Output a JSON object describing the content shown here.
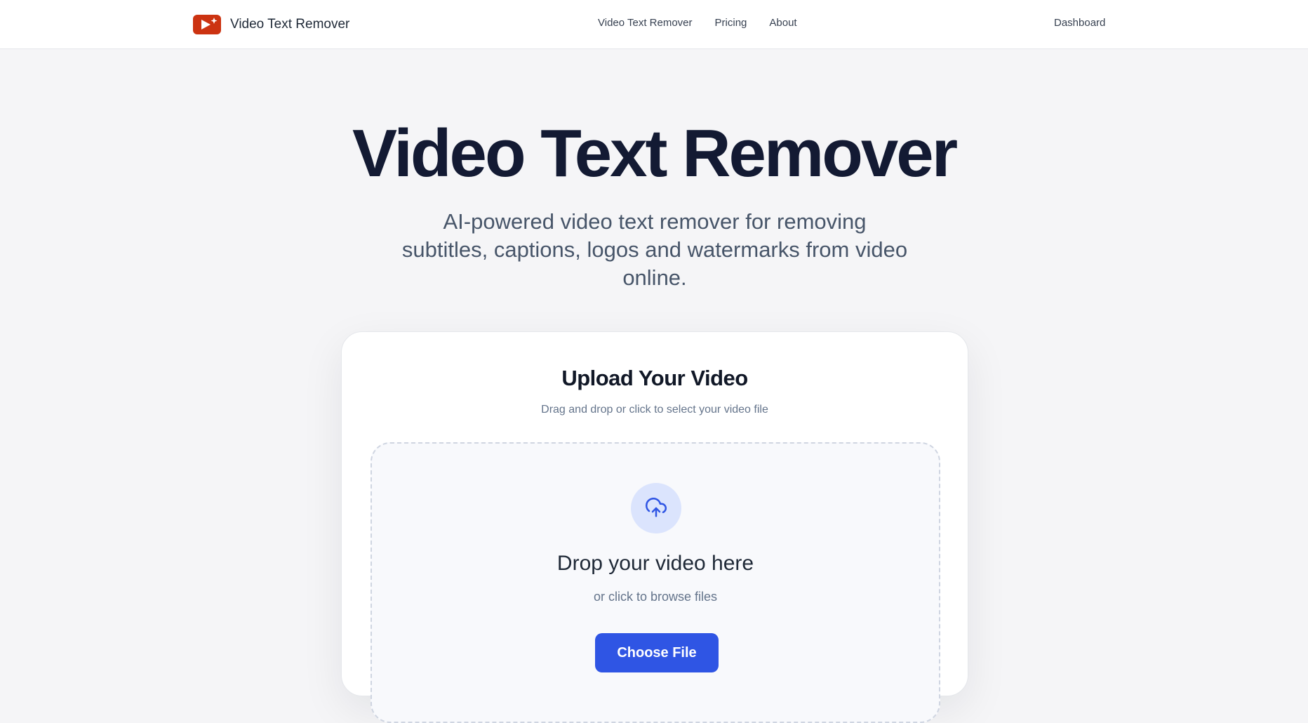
{
  "header": {
    "brand_name": "Video Text Remover",
    "logo_icon": "video-magic-icon",
    "nav": [
      "Video Text Remover",
      "Pricing",
      "About"
    ],
    "dashboard_label": "Dashboard"
  },
  "hero": {
    "title": "Video Text Remover",
    "subtitle": "AI-powered video text remover for removing subtitles, captions, logos and watermarks from video online."
  },
  "upload": {
    "title": "Upload Your Video",
    "subtitle": "Drag and drop or click to select your video file",
    "icon": "cloud-upload-icon",
    "drop_title": "Drop your video here",
    "drop_sub": "or click to browse files",
    "button_label": "Choose File"
  },
  "colors": {
    "brand": "#cc3311",
    "accent": "#2f55e4",
    "page_bg": "#f5f5f7"
  }
}
